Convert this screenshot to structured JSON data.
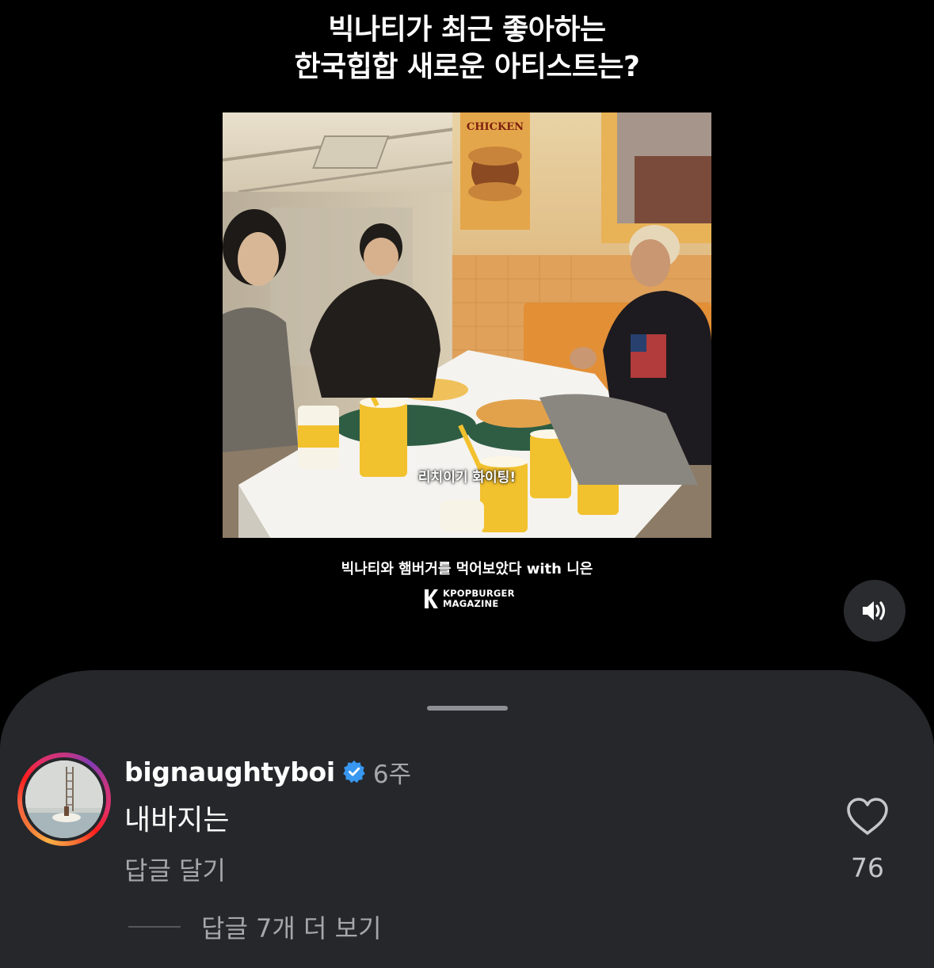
{
  "video": {
    "title_line1": "빅나티가 최근 좋아하는",
    "title_line2": "한국힙합 새로운 아티스트는?",
    "subtitle": "리치이기 화이팅!",
    "caption": "빅나티와 햄버거를 먹어보았다 with 니은",
    "brand_line1": "KPOPBURGER",
    "brand_line2": "MAGAZINE",
    "poster_text": "CHICKEN"
  },
  "comment": {
    "username": "bignaughtyboi",
    "time": "6주",
    "text": "내바지는",
    "reply_label": "답글 달기",
    "like_count": "76",
    "more_replies_label": "답글 7개 더 보기"
  },
  "colors": {
    "background": "#000000",
    "sheet": "#25272b",
    "verified": "#3897f0",
    "secondary_text": "#a5a7ab"
  },
  "icons": {
    "sound": "speaker-on-icon",
    "verified": "verified-badge-icon",
    "like": "heart-outline-icon"
  }
}
